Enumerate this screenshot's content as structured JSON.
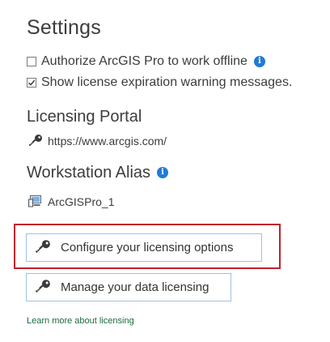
{
  "settings": {
    "title": "Settings",
    "authorize_offline": {
      "label": "Authorize ArcGIS Pro to work offline",
      "checked": false
    },
    "show_expiration": {
      "label": "Show license expiration warning messages.",
      "checked": true
    }
  },
  "licensing_portal": {
    "title": "Licensing Portal",
    "url": "https://www.arcgis.com/"
  },
  "workstation_alias": {
    "title": "Workstation Alias",
    "value": "ArcGISPro_1"
  },
  "buttons": {
    "configure_label": "Configure your licensing options",
    "manage_label": "Manage your data licensing"
  },
  "learn_more_label": "Learn more about licensing",
  "icons": {
    "info": "info-icon",
    "key": "key-icon",
    "computer": "computer-icon"
  },
  "colors": {
    "accent_blue": "#1f7bd6",
    "highlight_red": "#c0212c",
    "link_green": "#1a6b3a"
  }
}
